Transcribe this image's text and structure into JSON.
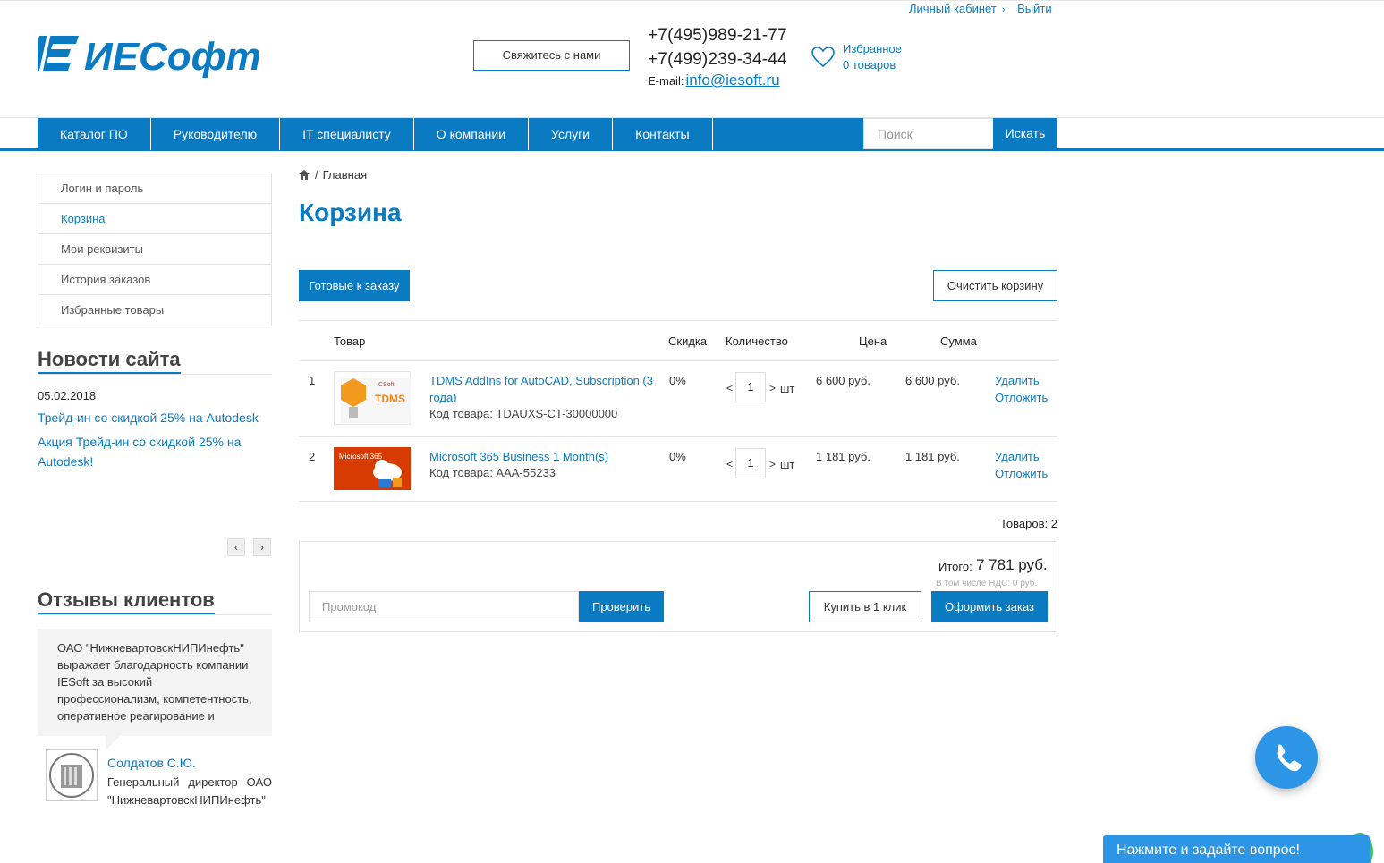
{
  "account": {
    "cabinet": "Личный кабинет",
    "logout": "Выйти"
  },
  "header": {
    "logo_text": "ИЕСофт",
    "contact_button": "Свяжитесь с нами",
    "phone1": "+7(495)989-21-77",
    "phone2": "+7(499)239-34-44",
    "email_label": "E-mail:",
    "email": "info@iesoft.ru",
    "favorites_title": "Избранное",
    "favorites_count": "0 товаров"
  },
  "nav": {
    "items": [
      "Каталог ПО",
      "Руководителю",
      "IT специалисту",
      "О компании",
      "Услуги",
      "Контакты"
    ],
    "search_placeholder": "Поиск",
    "search_button": "Искать"
  },
  "sidebar": {
    "menu": [
      "Логин и пароль",
      "Корзина",
      "Мои реквизиты",
      "История заказов",
      "Избранные товары"
    ],
    "news_title": "Новости сайта",
    "news_date": "05.02.2018",
    "news": [
      "Трейд-ин со скидкой 25% на Autodesk",
      "Акция Трейд-ин со скидкой 25% на Autodesk!"
    ],
    "reviews_title": "Отзывы клиентов",
    "review_text": "ОАО \"НижневартовскНИПИнефть\" выражает благодарность компании IESoft за высокий профессионализм, компетентность, оперативное реагирование и",
    "review_name": "Солдатов С.Ю.",
    "review_position": "Генеральный директор ОАО \"НижневартовскНИПИнефть\""
  },
  "main": {
    "breadcrumb": "Главная",
    "title": "Корзина",
    "ready_button": "Готовые к заказу",
    "clear_button": "Очистить корзину",
    "columns": {
      "product": "Товар",
      "discount": "Скидка",
      "quantity": "Количество",
      "price": "Цена",
      "sum": "Сумма"
    },
    "items": [
      {
        "num": "1",
        "thumb_text": "TDMS",
        "name": "TDMS AddIns for AutoCAD, Subscription (3 года)",
        "code": "Код товара: TDAUXS-CT-30000000",
        "discount": "0%",
        "qty": "1",
        "unit": "шт",
        "price": "6 600 руб.",
        "sum": "6 600 руб.",
        "delete": "Удалить",
        "postpone": "Отложить"
      },
      {
        "num": "2",
        "thumb_text": "Microsoft 365",
        "name": "Microsoft 365 Business 1 Month(s)",
        "code": "Код товара: AAA-55233",
        "discount": "0%",
        "qty": "1",
        "unit": "шт",
        "price": "1 181 руб.",
        "sum": "1 181 руб.",
        "delete": "Удалить",
        "postpone": "Отложить"
      }
    ],
    "qty_dec": "<",
    "qty_inc": ">",
    "items_count": "Товаров: 2",
    "total_label": "Итого:",
    "total_value": "7 781 руб.",
    "vat": "В том числе НДС: 0 руб.",
    "promo_placeholder": "Промокод",
    "check_button": "Проверить",
    "one_click_button": "Купить в 1 клик",
    "order_button": "Оформить заказ"
  },
  "widgets": {
    "chat": "Нажмите и задайте вопрос!"
  },
  "colors": {
    "brand": "#0a7bc2",
    "fab": "#2c95e6",
    "ms_orange": "#d83b01"
  }
}
